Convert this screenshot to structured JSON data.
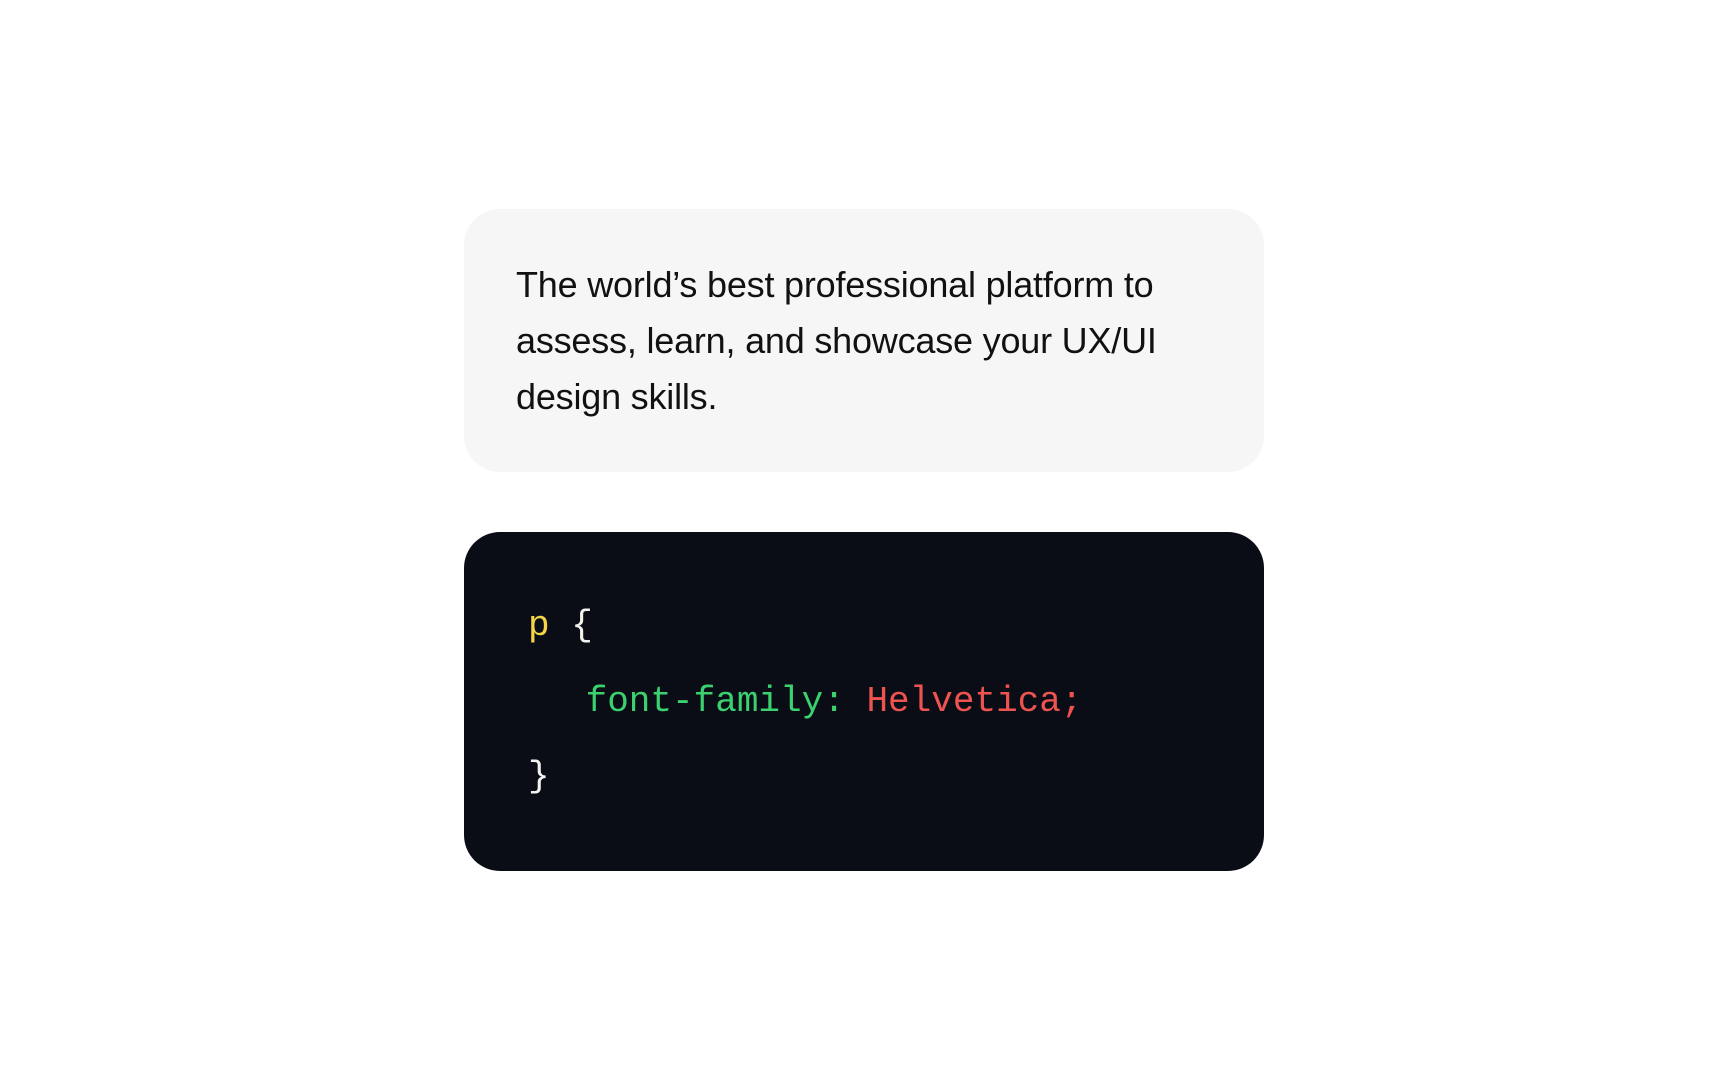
{
  "description": {
    "text": "The world’s best professional platform to assess, learn, and showcase your UX/UI design skills."
  },
  "code": {
    "selector": "p",
    "brace_open": "{",
    "property": "font-family",
    "colon": ":",
    "value": "Helvetica",
    "semicolon": ";",
    "brace_close": "}"
  }
}
